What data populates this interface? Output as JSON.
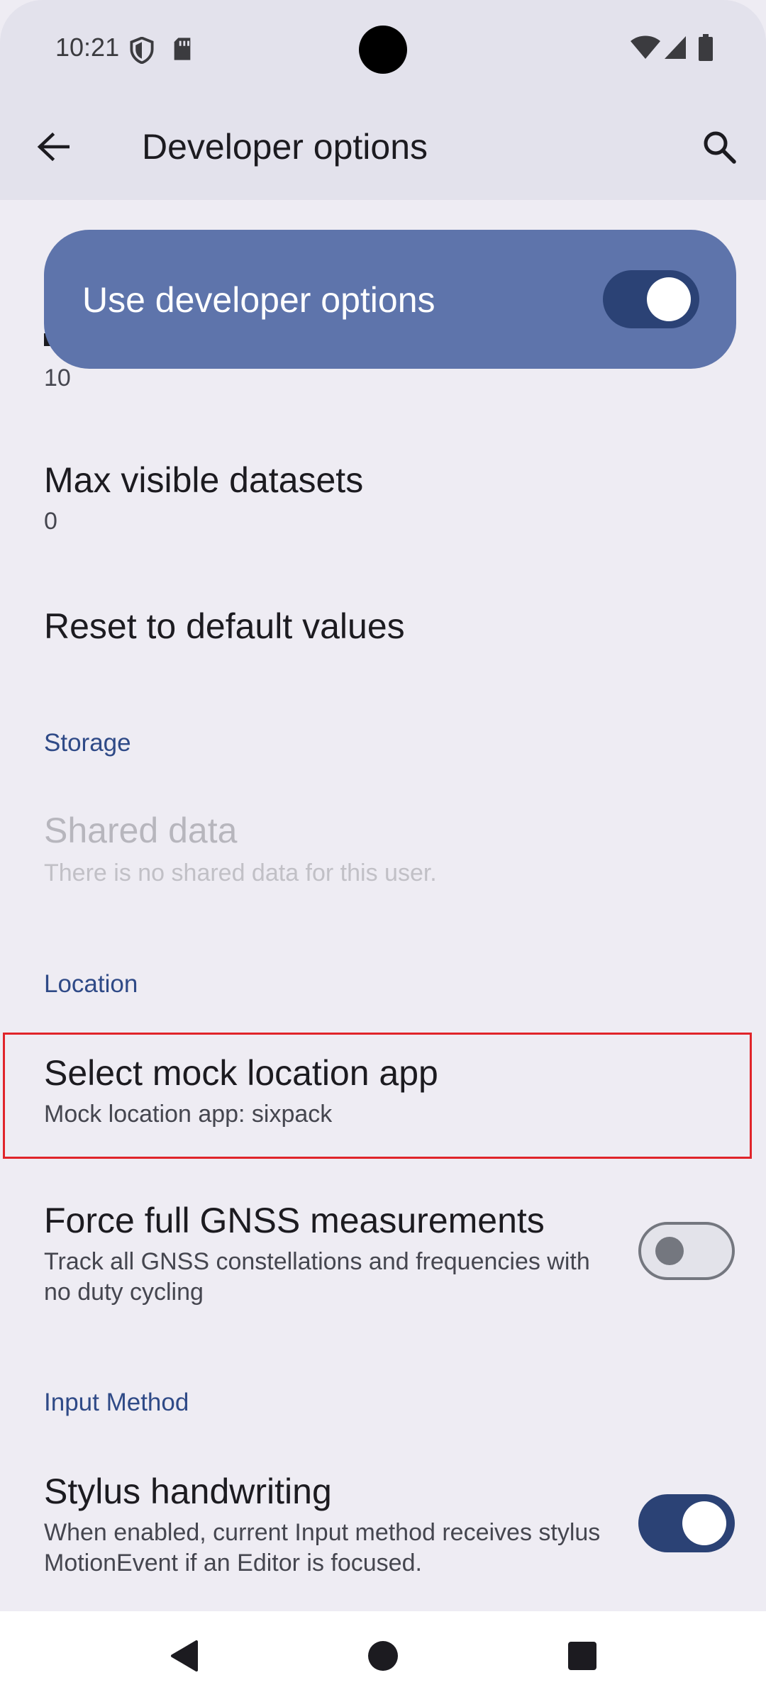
{
  "status_bar": {
    "time": "10:21",
    "icons_left": [
      "shield-icon",
      "sd-card-icon"
    ],
    "icons_right": [
      "wifi-icon",
      "signal-icon",
      "battery-icon"
    ]
  },
  "app_bar": {
    "title": "Developer options",
    "back_icon": "arrow-back-icon",
    "search_icon": "search-icon"
  },
  "master_switch": {
    "label": "Use developer options",
    "checked": true
  },
  "items": {
    "partial": {
      "summary": "10"
    },
    "max_visible_datasets": {
      "title": "Max visible datasets",
      "summary": "0"
    },
    "reset_defaults": {
      "title": "Reset to default values"
    },
    "storage_header": "Storage",
    "shared_data": {
      "title": "Shared data",
      "summary": "There is no shared data for this user."
    },
    "location_header": "Location",
    "mock_location": {
      "title": "Select mock location app",
      "summary": "Mock location app: sixpack"
    },
    "gnss": {
      "title": "Force full GNSS measurements",
      "summary": "Track all GNSS constellations and frequencies with no duty cycling",
      "checked": false
    },
    "input_header": "Input Method",
    "stylus": {
      "title": "Stylus handwriting",
      "summary": "When enabled, current Input method receives stylus MotionEvent if an Editor is focused.",
      "checked": true
    }
  },
  "nav_bar": {
    "icons": [
      "nav-back-icon",
      "nav-home-icon",
      "nav-recents-icon"
    ]
  },
  "colors": {
    "accent": "#2f4a87",
    "card": "#5e74ab",
    "highlight": "#e0242a"
  }
}
